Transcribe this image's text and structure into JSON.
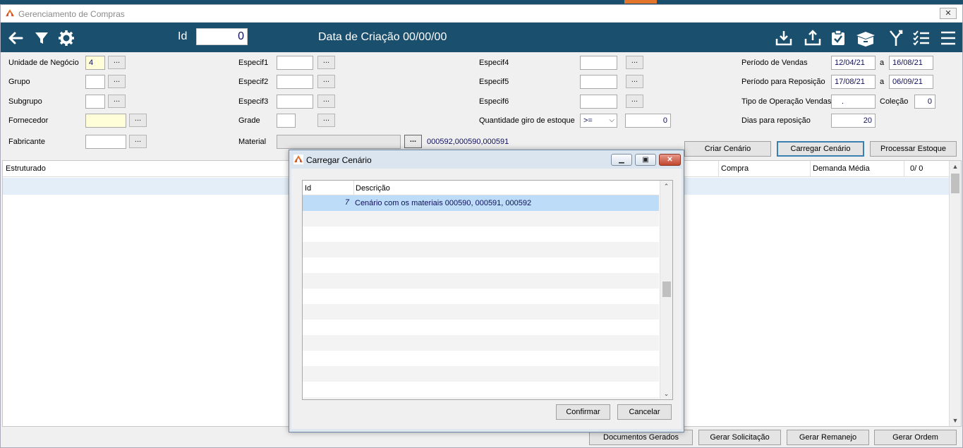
{
  "window": {
    "title": "Gerenciamento de Compras",
    "close_label": "✕"
  },
  "toolbar": {
    "icons": [
      "back-arrow-icon",
      "filter-icon",
      "gear-icon",
      "download-icon",
      "upload-icon",
      "clipboard-check-icon",
      "box-icon",
      "merge-icon",
      "checklist-icon",
      "menu-icon"
    ],
    "id_label": "Id",
    "id_value": "0",
    "date_label": "Data de Criação 00/00/00"
  },
  "form": {
    "unidade_label": "Unidade de Negócio",
    "unidade_value": "4",
    "grupo_label": "Grupo",
    "subgrupo_label": "Subgrupo",
    "fornecedor_label": "Fornecedor",
    "fabricante_label": "Fabricante",
    "especif1_label": "Especif1",
    "especif2_label": "Especif2",
    "especif3_label": "Especif3",
    "grade_label": "Grade",
    "material_label": "Material",
    "material_codes": "000592,000590,000591",
    "especif4_label": "Especif4",
    "especif5_label": "Especif5",
    "especif6_label": "Especif6",
    "giro_label": "Quantidade giro de estoque",
    "giro_operator": ">=",
    "giro_value": "0",
    "periodo_vendas_label": "Período de Vendas",
    "periodo_vendas_from": "12/04/21",
    "periodo_vendas_to": "16/08/21",
    "periodo_reposicao_label": "Período para Reposição",
    "periodo_reposicao_from": "17/08/21",
    "periodo_reposicao_to": "06/09/21",
    "a_label": "a",
    "tipo_operacao_label": "Tipo de Operação Vendas",
    "tipo_operacao_value": ".",
    "colecao_label": "Coleção",
    "colecao_value": "0",
    "dias_reposicao_label": "Dias para reposição",
    "dias_reposicao_value": "20",
    "dots_label": "..."
  },
  "actions": {
    "criar_cenario": "Criar Cenário",
    "carregar_cenario": "Carregar Cenário",
    "processar_estoque": "Processar Estoque"
  },
  "grid": {
    "col_estruturado": "Estruturado",
    "col_compra": "Compra",
    "col_demanda": "Demanda Média",
    "counter": "0/  0"
  },
  "footer": {
    "documentos_gerados": "Documentos Gerados",
    "gerar_solicitacao": "Gerar Solicitação",
    "gerar_remanejo": "Gerar Remanejo",
    "gerar_ordem": "Gerar Ordem"
  },
  "dialog": {
    "title": "Carregar Cenário",
    "col_id": "Id",
    "col_descricao": "Descrição",
    "rows": [
      {
        "id": "7",
        "descricao": "Cenário com os materiais 000590, 000591, 000592"
      }
    ],
    "confirmar": "Confirmar",
    "cancelar": "Cancelar"
  }
}
